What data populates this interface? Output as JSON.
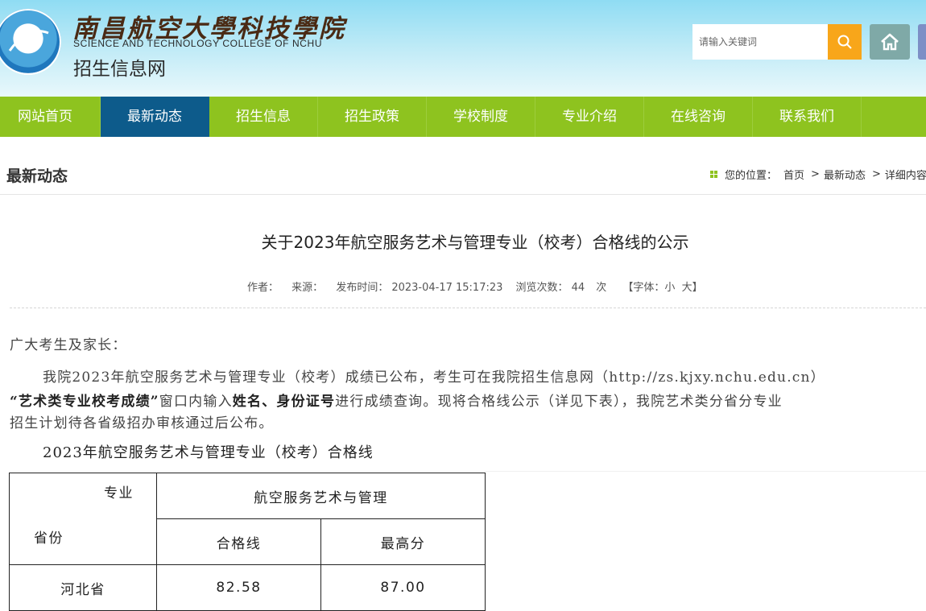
{
  "header": {
    "school_name_cn": "南昌航空大學科技學院",
    "school_name_en": "SCIENCE AND TECHNOLOGY COLLEGE OF NCHU",
    "site_name": "招生信息网",
    "search_placeholder": "请输入关键词",
    "search_icon": "search-icon",
    "home_icon": "home-icon"
  },
  "nav": {
    "items": [
      "网站首页",
      "最新动态",
      "招生信息",
      "招生政策",
      "学校制度",
      "专业介绍",
      "在线咨询",
      "联系我们"
    ],
    "active_index": 1
  },
  "section": {
    "title": "最新动态",
    "breadcrumb_label": "您的位置：",
    "breadcrumb": [
      "首页",
      "最新动态",
      "详细内容"
    ]
  },
  "article": {
    "title": "关于2023年航空服务艺术与管理专业（校考）合格线的公示",
    "meta": {
      "author_label": "作者：",
      "source_label": "来源：",
      "publish_label": "发布时间：",
      "publish_time": "2023-04-17 15:17:23",
      "views_label": "浏览次数：",
      "views": "44",
      "views_unit": "次",
      "font_size_label": "【字体：",
      "font_small": "小",
      "font_large": "大",
      "font_close": "】"
    },
    "greeting": "广大考生及家长：",
    "para1_line1": "我院2023年航空服务艺术与管理专业（校考）成绩已公布，考生可在我院招生信息网（http://zs.kjxy.nchu.edu.cn）",
    "para1_quote": "“艺术类专业校考成绩”",
    "para1_mid": "窗口内输入",
    "para1_name": "姓名、身份证号",
    "para1_rest": "进行成绩查询。现将合格线公示（详见下表），我院艺术类分省分专业",
    "para1_line3": "招生计划待各省级招办审核通过后公布。",
    "table_title": "2023年航空服务艺术与管理专业（校考）合格线",
    "table": {
      "corner_major": "专业",
      "corner_province": "省份",
      "major": "航空服务艺术与管理",
      "col_pass": "合格线",
      "col_max": "最高分",
      "rows": [
        {
          "province": "河北省",
          "pass": "82.58",
          "max": "87.00"
        }
      ]
    }
  }
}
